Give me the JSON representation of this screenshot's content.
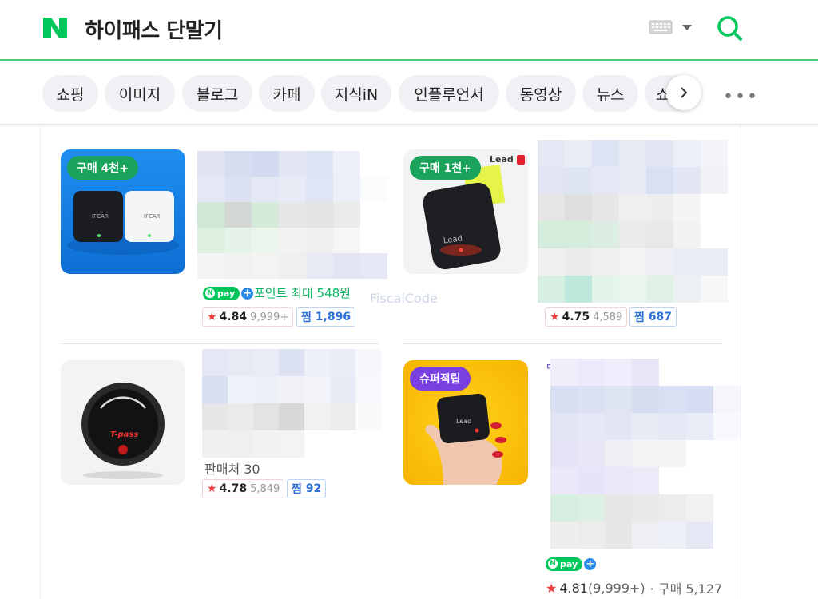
{
  "header": {
    "logo": "N",
    "query": "하이패스 단말기",
    "icons": {
      "keyboard": "keyboard-icon",
      "dropdown": "chevron-down-icon",
      "search": "search-icon"
    },
    "brand_color": "#03c75a"
  },
  "tabs": [
    "쇼핑",
    "이미지",
    "블로그",
    "카페",
    "지식iN",
    "인플루언서",
    "동영상",
    "뉴스",
    "쇼"
  ],
  "products": [
    {
      "badge": "구매 4천+",
      "device_label_1": "IFCAR",
      "device_label_2": "IFCAR",
      "npay": "pay",
      "point_text": "포인트 최대 548원",
      "rating": "4.84",
      "reviews": "9,999+",
      "zzim_label": "찜",
      "zzim": "1,896"
    },
    {
      "badge": "구매 1천+",
      "brand": "Lead",
      "device_label": "Lead",
      "rating": "4.75",
      "reviews": "4,589",
      "zzim_label": "찜",
      "zzim": "687"
    },
    {
      "device_label": "T-pass",
      "seller_text": "판매처 30",
      "rating": "4.78",
      "reviews": "5,849",
      "zzim_label": "찜",
      "zzim": "92"
    },
    {
      "badge": "슈퍼적립",
      "device_label": "Lead",
      "npay": "pay",
      "rating": "4.81",
      "reviews": "(9,999+)",
      "purchases": "· 구매 5,127"
    }
  ],
  "watermark": "FiscalCode",
  "colors": {
    "accent_green": "#03c75a",
    "badge_green": "#1aa35a",
    "badge_purple": "#7a3fe0",
    "npay_blue": "#2b8be8",
    "star_red": "#ea3e3e",
    "zzim_blue": "#2c6fd6"
  }
}
